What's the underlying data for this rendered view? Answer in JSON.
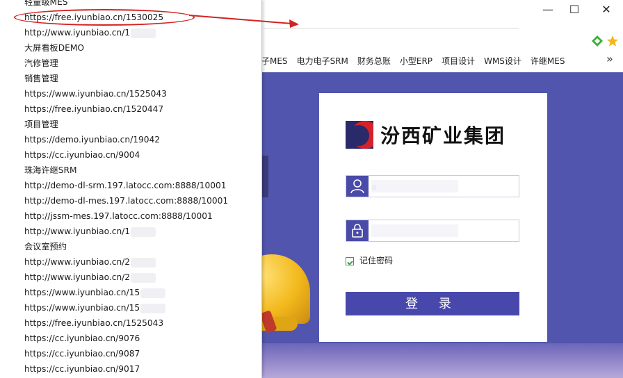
{
  "window": {
    "minimize_glyph": "—",
    "maximize_glyph": "☐",
    "close_glyph": "✕"
  },
  "extensions": [
    {
      "icon": "green-diamond-icon",
      "color": "#3cae3c"
    },
    {
      "icon": "star-icon",
      "color": "#f2b81f"
    }
  ],
  "bookmarks": {
    "items": [
      "子MES",
      "电力电子SRM",
      "财务总账",
      "小型ERP",
      "项目设计",
      "WMS设计",
      "许继MES"
    ],
    "overflow_glyph": "»"
  },
  "history": {
    "items": [
      {
        "text": "轻量级MES"
      },
      {
        "text": "https://free.iyunbiao.cn/1530025"
      },
      {
        "text": "http://www.iyunbiao.cn/1",
        "masked": true
      },
      {
        "text": "大屏看板DEMO"
      },
      {
        "text": "汽修管理"
      },
      {
        "text": "销售管理"
      },
      {
        "text": "https://www.iyunbiao.cn/1525043"
      },
      {
        "text": "https://free.iyunbiao.cn/1520447"
      },
      {
        "text": "项目管理"
      },
      {
        "text": "https://demo.iyunbiao.cn/19042"
      },
      {
        "text": "https://cc.iyunbiao.cn/9004"
      },
      {
        "text": "珠海许继SRM"
      },
      {
        "text": "http://demo-dl-srm.197.latocc.com:8888/10001"
      },
      {
        "text": "http://demo-dl-mes.197.latocc.com:8888/10001"
      },
      {
        "text": "http://jssm-mes.197.latocc.com:8888/10001"
      },
      {
        "text": "http://www.iyunbiao.cn/1",
        "masked": true
      },
      {
        "text": "会议室预约"
      },
      {
        "text": "http://www.iyunbiao.cn/2",
        "masked": true
      },
      {
        "text": "http://www.iyunbiao.cn/2",
        "masked": true
      },
      {
        "text": "https://www.iyunbiao.cn/15",
        "masked": true
      },
      {
        "text": "https://www.iyunbiao.cn/15",
        "masked": true
      },
      {
        "text": "https://free.iyunbiao.cn/1525043"
      },
      {
        "text": "https://cc.iyunbiao.cn/9076"
      },
      {
        "text": "https://cc.iyunbiao.cn/9087"
      },
      {
        "text": "https://cc.iyunbiao.cn/9017"
      }
    ],
    "highlight_color": "#d32222"
  },
  "login": {
    "company_name": "汾西矿业集团",
    "username_value": "a",
    "password_value": "",
    "remember_label": "记住密码",
    "remember_checked": true,
    "submit_label": "登 录",
    "brand_color": "#4848ac",
    "logo_red": "#d72128"
  }
}
